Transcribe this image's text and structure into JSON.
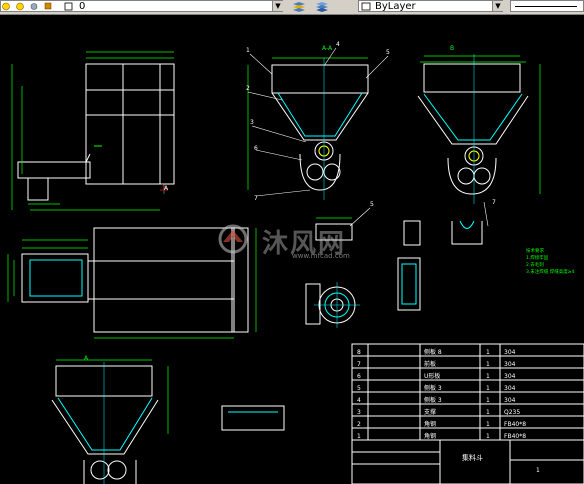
{
  "toolbar": {
    "layer_name": "0",
    "color_value": "ByLayer",
    "colors": {
      "face": "#d4d0c8",
      "shadow": "#808080"
    }
  },
  "drawing": {
    "background": "#000000",
    "colors": {
      "outline": "#ffffff",
      "dim": "#00ff00",
      "annot": "#00ffff",
      "leader": "#ffff00",
      "red": "#ff0000"
    },
    "section_labels": [
      "A-A",
      "B",
      "A",
      "A"
    ],
    "leader_numbers": [
      "1",
      "4",
      "2",
      "5",
      "3",
      "6",
      "7",
      "7",
      "5"
    ],
    "notes": [
      "技术要求",
      "1.焊接牢固",
      "2.去毛刺",
      "3.未注焊缝 焊缝高度≥4"
    ]
  },
  "bom": {
    "rows": [
      {
        "no": "8",
        "name": "侧板 8",
        "qty": "1",
        "material": "304"
      },
      {
        "no": "7",
        "name": "前板",
        "qty": "1",
        "material": "304"
      },
      {
        "no": "6",
        "name": "U形板",
        "qty": "1",
        "material": "304"
      },
      {
        "no": "5",
        "name": "侧板 3",
        "qty": "1",
        "material": "304"
      },
      {
        "no": "4",
        "name": "侧板 3",
        "qty": "1",
        "material": "304"
      },
      {
        "no": "3",
        "name": "支撑",
        "qty": "1",
        "material": "Q235"
      },
      {
        "no": "2",
        "name": "角钢",
        "qty": "1",
        "material": "FB40*8"
      },
      {
        "no": "1",
        "name": "角钢",
        "qty": "1",
        "material": "FB40*8"
      }
    ],
    "title": "集料斗",
    "scale": "1"
  },
  "watermark": {
    "brand": "沐风网",
    "url": "www.mfcad.com"
  }
}
